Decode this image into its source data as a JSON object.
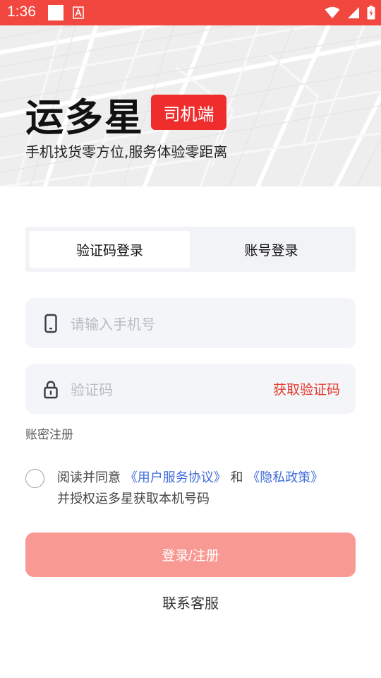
{
  "status_bar": {
    "time": "1:36"
  },
  "brand": {
    "name": "运多星",
    "badge": "司机端",
    "slogan": "手机找货零方位,服务体验零距离"
  },
  "tabs": [
    {
      "label": "验证码登录",
      "active": true
    },
    {
      "label": "账号登录",
      "active": false
    }
  ],
  "phone_field": {
    "placeholder": "请输入手机号",
    "value": "",
    "icon": "phone-icon"
  },
  "code_field": {
    "placeholder": "验证码",
    "value": "",
    "icon": "lock-icon",
    "get_code_label": "获取验证码"
  },
  "register_link": "账密注册",
  "agreement": {
    "checked": false,
    "prefix": "阅读并同意",
    "user_agreement": "《用户服务协议》",
    "and": "和",
    "privacy_policy": "《隐私政策》",
    "line2": "并授权运多星获取本机号码"
  },
  "submit_label": "登录/注册",
  "customer_service": "联系客服",
  "colors": {
    "status_bar": "#f2473f",
    "accent": "#ef2d2d",
    "submit_disabled": "#f89a93",
    "link": "#3f6bd8"
  }
}
